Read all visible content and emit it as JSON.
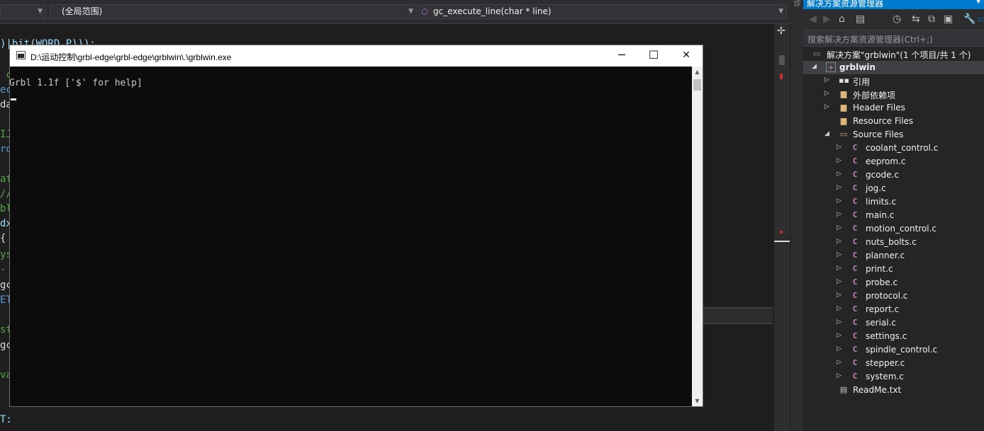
{
  "nav": {
    "scope": "(全局范围)",
    "function": "gc_execute_line(char * line)"
  },
  "editor": {
    "lines": [
      {
        "text": ")|bit(WORD_P)));",
        "color": "#9cdcfe"
      },
      {
        "text": " c",
        "color": "#57a64a"
      },
      {
        "text": "ec",
        "color": "#569cd6"
      },
      {
        "text": "da",
        "color": "#dcdcdc"
      },
      {
        "text": "IJ",
        "color": "#57a64a"
      },
      {
        "text": "rd",
        "color": "#569cd6"
      },
      {
        "text": "at",
        "color": "#57a64a"
      },
      {
        "text": "//",
        "color": "#57a64a"
      },
      {
        "text": "bl",
        "color": "#57a64a"
      },
      {
        "text": "dx",
        "color": "#9cdcfe"
      },
      {
        "text": "{",
        "color": "#dcdcdc"
      },
      {
        "text": "ys",
        "color": "#57a64a"
      },
      {
        "text": "-",
        "color": "#57a64a"
      },
      {
        "text": "gc",
        "color": "#dcdcdc"
      },
      {
        "text": "ET",
        "color": "#569cd6"
      },
      {
        "text": "st",
        "color": "#57a64a"
      },
      {
        "text": "gc",
        "color": "#dcdcdc"
      },
      {
        "text": "va",
        "color": "#57a64a"
      },
      {
        "text": "T:",
        "color": "#9cdcfe"
      }
    ]
  },
  "console": {
    "title": "D:\\运动控制\\grbl-edge\\grbl-edge\\grblwin\\.\\grblwin.exe",
    "output": "Grbl 1.1f ['$' for help]",
    "minimize": "─",
    "maximize": "☐",
    "close": "✕"
  },
  "solution_explorer": {
    "title": "解决方案资源管理器",
    "search_placeholder": "搜索解决方案资源管理器(Ctrl+;)",
    "solution": "解决方案\"grblwin\"(1 个项目/共 1 个)",
    "project": "grblwin",
    "nodes": [
      {
        "label": "引用",
        "icon": "references-icon"
      },
      {
        "label": "外部依赖项",
        "icon": "external-deps-icon"
      },
      {
        "label": "Header Files",
        "icon": "folder-icon"
      },
      {
        "label": "Resource Files",
        "icon": "folder-icon"
      },
      {
        "label": "Source Files",
        "icon": "folder-open-icon"
      }
    ],
    "source_files": [
      "coolant_control.c",
      "eeprom.c",
      "gcode.c",
      "jog.c",
      "limits.c",
      "main.c",
      "motion_control.c",
      "nuts_bolts.c",
      "planner.c",
      "print.c",
      "probe.c",
      "protocol.c",
      "report.c",
      "serial.c",
      "settings.c",
      "spindle_control.c",
      "stepper.c",
      "system.c"
    ],
    "readme": "ReadMe.txt",
    "c_icon_color": "#c586c0",
    "folder_color": "#dcb67a"
  }
}
